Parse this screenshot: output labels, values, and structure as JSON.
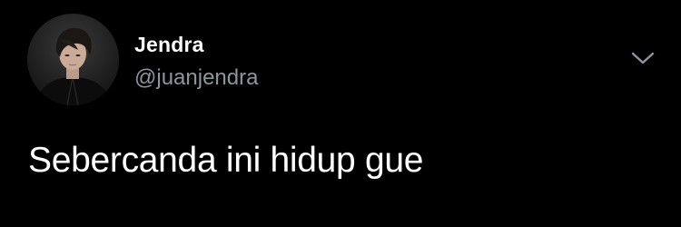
{
  "tweet": {
    "author": {
      "display_name": "Jendra",
      "handle": "@juanjendra",
      "avatar_icon": "profile-photo"
    },
    "text": "Sebercanda ini hidup gue",
    "menu_icon": "chevron-down-icon"
  },
  "colors": {
    "background": "#000000",
    "primary_text": "#ffffff",
    "secondary_text": "#8d959d"
  }
}
